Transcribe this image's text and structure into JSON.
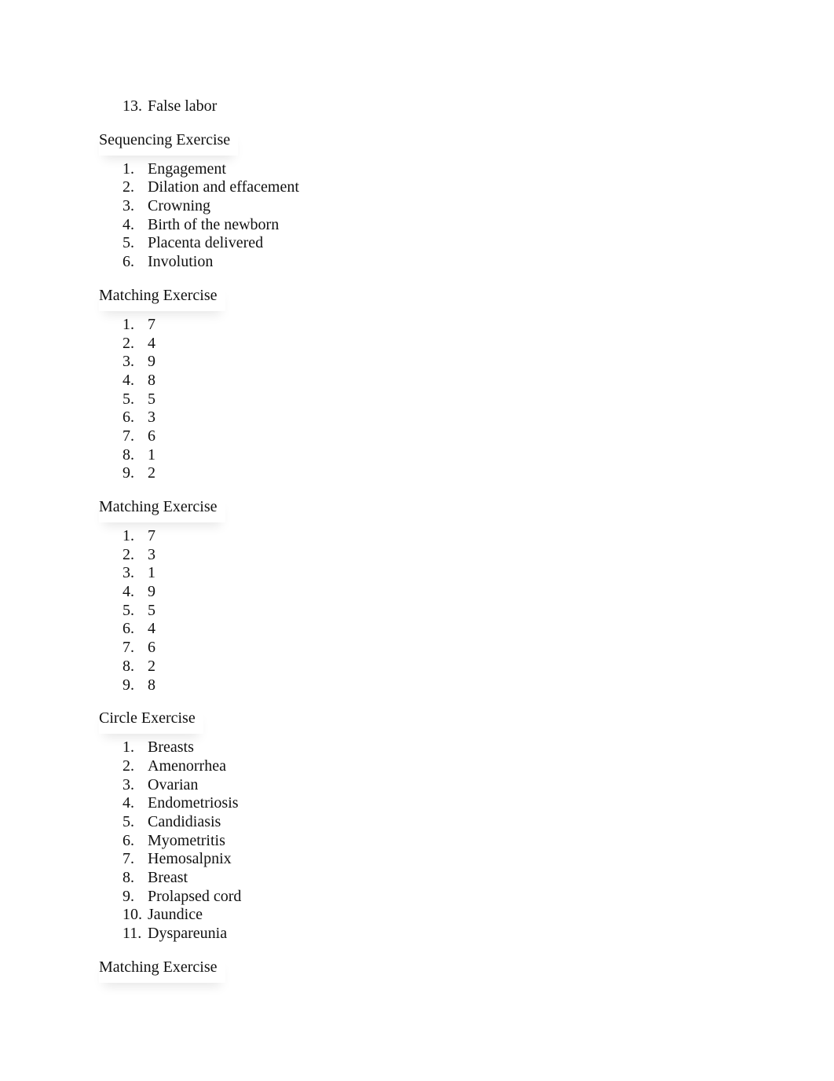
{
  "document": {
    "continued_item": {
      "number": "13.",
      "text": "False labor"
    },
    "sections": [
      {
        "heading": "Sequencing Exercise",
        "items": [
          {
            "number": "1.",
            "text": "Engagement"
          },
          {
            "number": "2.",
            "text": "Dilation and effacement"
          },
          {
            "number": "3.",
            "text": "Crowning"
          },
          {
            "number": "4.",
            "text": "Birth of the newborn"
          },
          {
            "number": "5.",
            "text": "Placenta delivered"
          },
          {
            "number": "6.",
            "text": "Involution"
          }
        ]
      },
      {
        "heading": "Matching Exercise",
        "items": [
          {
            "number": "1.",
            "text": "7"
          },
          {
            "number": "2.",
            "text": "4"
          },
          {
            "number": "3.",
            "text": "9"
          },
          {
            "number": "4.",
            "text": "8"
          },
          {
            "number": "5.",
            "text": "5"
          },
          {
            "number": "6.",
            "text": "3"
          },
          {
            "number": "7.",
            "text": "6"
          },
          {
            "number": "8.",
            "text": "1"
          },
          {
            "number": "9.",
            "text": "2"
          }
        ]
      },
      {
        "heading": "Matching Exercise",
        "items": [
          {
            "number": "1.",
            "text": "7"
          },
          {
            "number": "2.",
            "text": "3"
          },
          {
            "number": "3.",
            "text": "1"
          },
          {
            "number": "4.",
            "text": "9"
          },
          {
            "number": "5.",
            "text": "5"
          },
          {
            "number": "6.",
            "text": "4"
          },
          {
            "number": "7.",
            "text": "6"
          },
          {
            "number": "8.",
            "text": "2"
          },
          {
            "number": "9.",
            "text": "8"
          }
        ]
      },
      {
        "heading": "Circle Exercise",
        "items": [
          {
            "number": "1.",
            "text": "Breasts"
          },
          {
            "number": "2.",
            "text": "Amenorrhea"
          },
          {
            "number": "3.",
            "text": "Ovarian"
          },
          {
            "number": "4.",
            "text": "Endometriosis"
          },
          {
            "number": "5.",
            "text": "Candidiasis"
          },
          {
            "number": "6.",
            "text": "Myometritis"
          },
          {
            "number": "7.",
            "text": "Hemosalpnix"
          },
          {
            "number": "8.",
            "text": "Breast"
          },
          {
            "number": "9.",
            "text": "Prolapsed cord"
          },
          {
            "number": "10.",
            "text": "Jaundice"
          },
          {
            "number": "11.",
            "text": "Dyspareunia"
          }
        ]
      },
      {
        "heading": "Matching Exercise",
        "items": []
      }
    ]
  }
}
